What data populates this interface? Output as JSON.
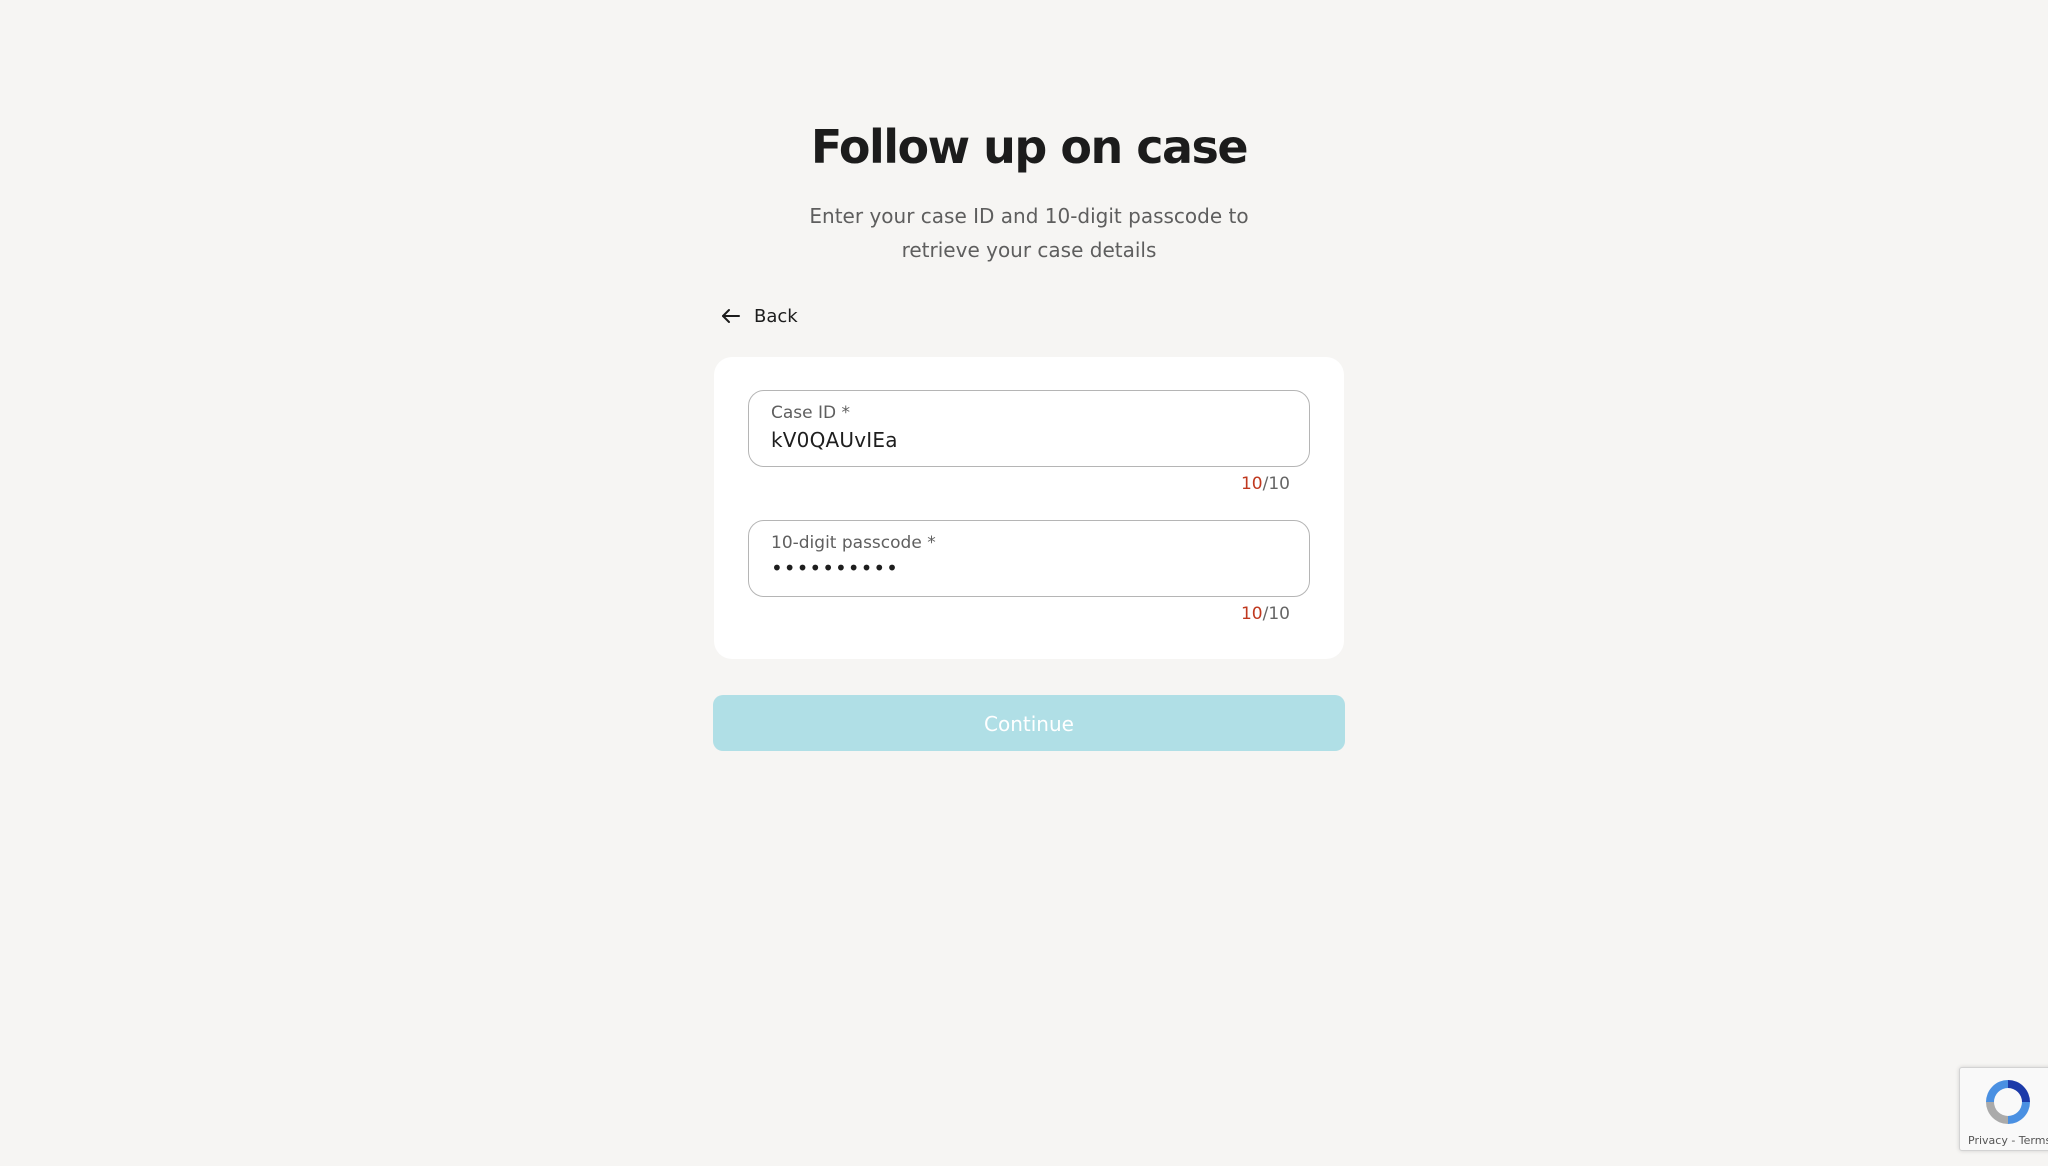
{
  "header": {
    "title": "Follow up on case",
    "subtitle": "Enter your case ID and 10-digit passcode to retrieve your case details"
  },
  "nav": {
    "back_label": "Back"
  },
  "form": {
    "case_id": {
      "label": "Case ID *",
      "value": "kV0QAUvIEa",
      "count_current": "10",
      "count_separator": "/",
      "count_max": "10"
    },
    "passcode": {
      "label": "10-digit passcode *",
      "value": "••••••••••",
      "count_current": "10",
      "count_separator": "/",
      "count_max": "10"
    },
    "submit_label": "Continue"
  },
  "recaptcha": {
    "privacy_label": "Privacy",
    "separator": " - ",
    "terms_label": "Terms"
  },
  "colors": {
    "background": "#f6f5f3",
    "card": "#ffffff",
    "button_disabled": "#b0dfe6",
    "counter_accent": "#c0391f"
  },
  "icons": {
    "back": "arrow-left-icon",
    "recaptcha": "recaptcha-logo-icon"
  }
}
